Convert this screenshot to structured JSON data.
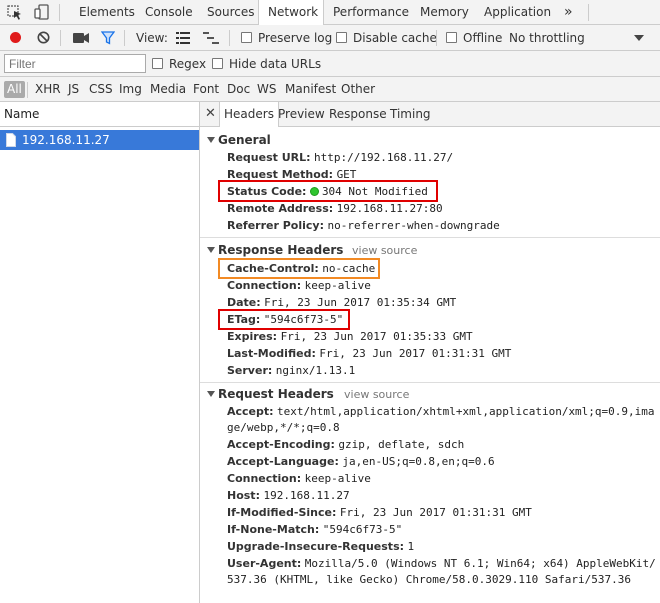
{
  "tabs": [
    {
      "label": "Elements"
    },
    {
      "label": "Console"
    },
    {
      "label": "Sources"
    },
    {
      "label": "Network"
    },
    {
      "label": "Performance"
    },
    {
      "label": "Memory"
    },
    {
      "label": "Application"
    }
  ],
  "tabs_overflow": "»",
  "toolbar": {
    "view_label": "View:",
    "preserve_log": "Preserve log",
    "disable_cache": "Disable cache",
    "offline": "Offline",
    "throttling": "No throttling"
  },
  "filter": {
    "placeholder": "Filter",
    "regex": "Regex",
    "hide_data_urls": "Hide data URLs"
  },
  "types": [
    "All",
    "XHR",
    "JS",
    "CSS",
    "Img",
    "Media",
    "Font",
    "Doc",
    "WS",
    "Manifest",
    "Other"
  ],
  "requests": {
    "column_name": "Name",
    "items": [
      {
        "name": "192.168.11.27"
      }
    ]
  },
  "detail_tabs": [
    "Headers",
    "Preview",
    "Response",
    "Timing"
  ],
  "general": {
    "title": "General",
    "rows": [
      {
        "key": "Request URL:",
        "value": "http://192.168.11.27/"
      },
      {
        "key": "Request Method:",
        "value": "GET"
      },
      {
        "key": "Status Code:",
        "value": "304 Not Modified"
      },
      {
        "key": "Remote Address:",
        "value": "192.168.11.27:80"
      },
      {
        "key": "Referrer Policy:",
        "value": "no-referrer-when-downgrade"
      }
    ]
  },
  "response_headers": {
    "title": "Response Headers",
    "view_source": "view source",
    "rows": [
      {
        "key": "Cache-Control:",
        "value": "no-cache"
      },
      {
        "key": "Connection:",
        "value": "keep-alive"
      },
      {
        "key": "Date:",
        "value": "Fri, 23 Jun 2017 01:35:34 GMT"
      },
      {
        "key": "ETag:",
        "value": "\"594c6f73-5\""
      },
      {
        "key": "Expires:",
        "value": "Fri, 23 Jun 2017 01:35:33 GMT"
      },
      {
        "key": "Last-Modified:",
        "value": "Fri, 23 Jun 2017 01:31:31 GMT"
      },
      {
        "key": "Server:",
        "value": "nginx/1.13.1"
      }
    ]
  },
  "request_headers": {
    "title": "Request Headers",
    "view_source": "view source",
    "accept_key": "Accept:",
    "accept_line1": "text/html,application/xhtml+xml,application/xml;q=0.9,ima",
    "accept_line2": "ge/webp,*/*;q=0.8",
    "rows": [
      {
        "key": "Accept-Encoding:",
        "value": "gzip, deflate, sdch"
      },
      {
        "key": "Accept-Language:",
        "value": "ja,en-US;q=0.8,en;q=0.6"
      },
      {
        "key": "Connection:",
        "value": "keep-alive"
      },
      {
        "key": "Host:",
        "value": "192.168.11.27"
      },
      {
        "key": "If-Modified-Since:",
        "value": "Fri, 23 Jun 2017 01:31:31 GMT"
      },
      {
        "key": "If-None-Match:",
        "value": "\"594c6f73-5\""
      },
      {
        "key": "Upgrade-Insecure-Requests:",
        "value": "1"
      }
    ],
    "ua_key": "User-Agent:",
    "ua_line1": "Mozilla/5.0 (Windows NT 6.1; Win64; x64) AppleWebKit/",
    "ua_line2": "537.36 (KHTML, like Gecko) Chrome/58.0.3029.110 Safari/537.36"
  },
  "colors": {
    "selected_row": "#3879d9",
    "highlight_red": "#e00000",
    "highlight_orange": "#f28a24",
    "status_ok": "#2fc52f",
    "record": "#e01b1b",
    "filter_icon": "#1a73e8"
  }
}
